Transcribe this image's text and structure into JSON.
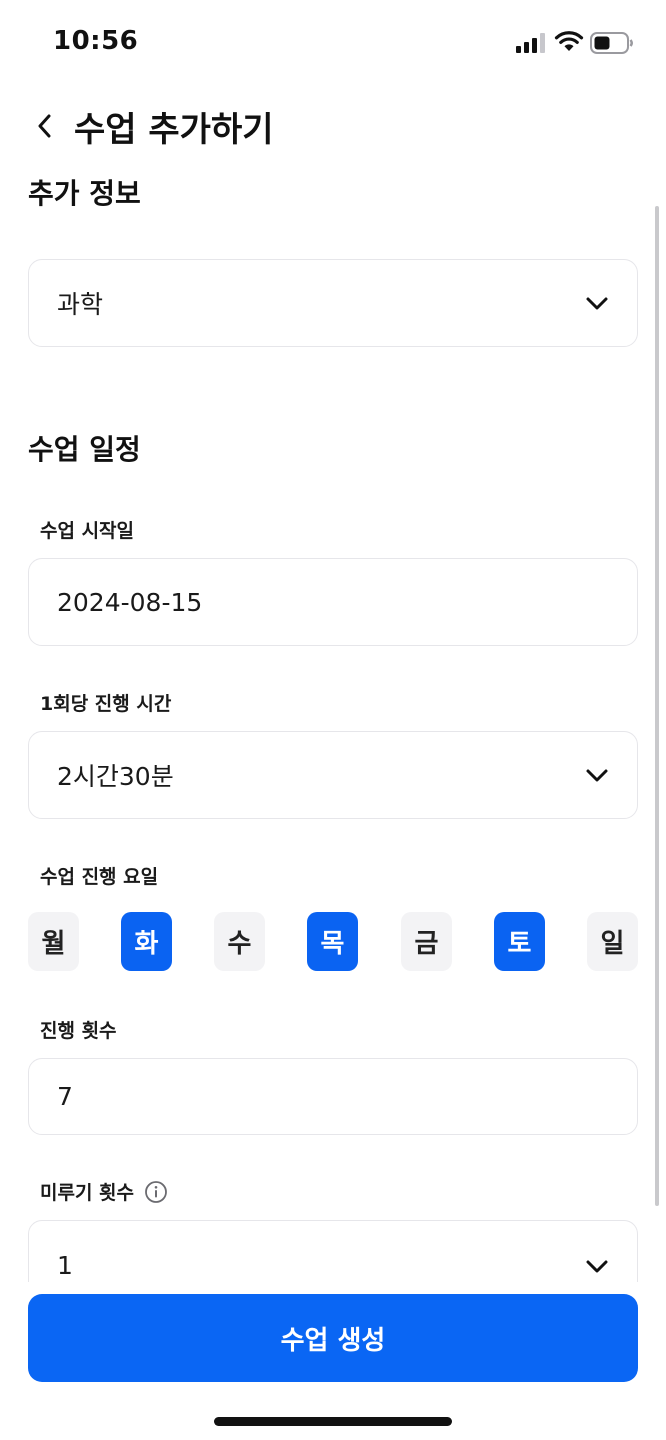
{
  "status_bar": {
    "time": "10:56"
  },
  "header": {
    "title": "수업 추가하기"
  },
  "additional_info": {
    "section_title": "추가 정보",
    "subject_value": "과학"
  },
  "schedule": {
    "section_title": "수업 일정",
    "start_date_label": "수업 시작일",
    "start_date_value": "2024-08-15",
    "duration_label": "1회당 진행 시간",
    "duration_value": "2시간30분",
    "days_label": "수업 진행 요일",
    "days": [
      {
        "label": "월",
        "selected": false
      },
      {
        "label": "화",
        "selected": true
      },
      {
        "label": "수",
        "selected": false
      },
      {
        "label": "목",
        "selected": true
      },
      {
        "label": "금",
        "selected": false
      },
      {
        "label": "토",
        "selected": true
      },
      {
        "label": "일",
        "selected": false
      }
    ],
    "sessions_label": "진행 횟수",
    "sessions_value": "7",
    "postpone_label": "미루기 횟수",
    "postpone_value": "1"
  },
  "footer": {
    "submit_label": "수업 생성"
  },
  "colors": {
    "accent": "#0a66f4",
    "day_inactive_bg": "#f3f3f5",
    "border": "#e6e6ea"
  }
}
